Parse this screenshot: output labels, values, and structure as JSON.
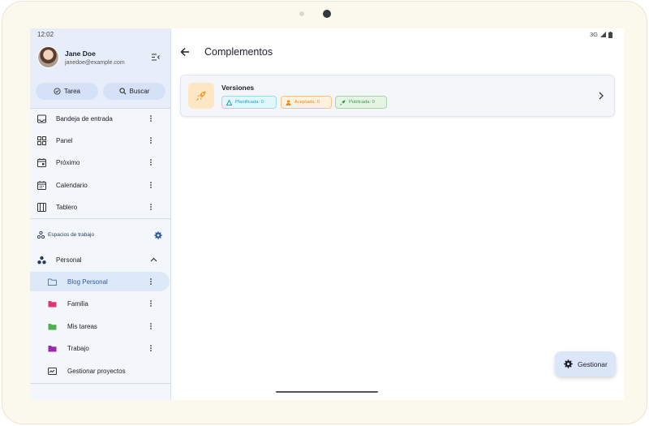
{
  "status_bar": {
    "time": "12:02",
    "network": "3G"
  },
  "user": {
    "name": "Jane Doe",
    "email": "janedoe@example.com"
  },
  "quick_actions": {
    "task_label": "Tarea",
    "search_label": "Buscar"
  },
  "nav": [
    {
      "label": "Bandeja de entrada",
      "icon": "inbox-icon"
    },
    {
      "label": "Panel",
      "icon": "dashboard-icon"
    },
    {
      "label": "Próximo",
      "icon": "calendar-upcoming-icon"
    },
    {
      "label": "Calendario",
      "icon": "calendar-icon"
    },
    {
      "label": "Tablero",
      "icon": "board-icon"
    }
  ],
  "workspaces": {
    "title": "Espacios de trabajo",
    "group": "Personal",
    "items": [
      {
        "label": "Blog Personal",
        "color": "#5b7db8",
        "selected": true
      },
      {
        "label": "Familia",
        "color": "#e0357a"
      },
      {
        "label": "Mis tareas",
        "color": "#4caf50"
      },
      {
        "label": "Trabajo",
        "color": "#9c27b0"
      }
    ],
    "manage_label": "Gestionar proyectos"
  },
  "page": {
    "title": "Complementos"
  },
  "card": {
    "title": "Versiones",
    "chips": [
      {
        "label": "Planificada: 0",
        "color": "#1aa3c7",
        "bg": "#e3f6fb",
        "border": "#9edbec"
      },
      {
        "label": "Aceptada: 0",
        "color": "#e68a1a",
        "bg": "#fdf1e0",
        "border": "#f2c48a"
      },
      {
        "label": "Publicada: 0",
        "color": "#3d9a45",
        "bg": "#e6f4e6",
        "border": "#a6d6a8"
      }
    ]
  },
  "fab": {
    "label": "Gestionar"
  }
}
